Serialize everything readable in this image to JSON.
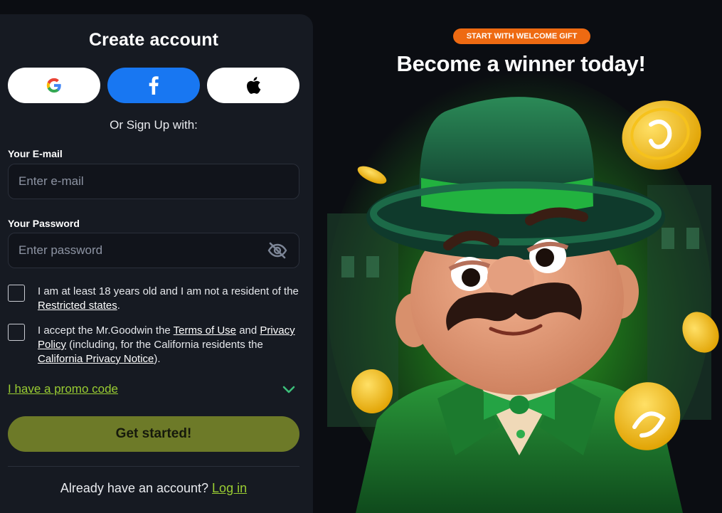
{
  "form": {
    "title": "Create account",
    "social_buttons": [
      "Google",
      "Facebook",
      "Apple"
    ],
    "or_text": "Or Sign Up with:",
    "email_label": "Your E-mail",
    "email_placeholder": "Enter e-mail",
    "password_label": "Your Password",
    "password_placeholder": "Enter password",
    "age_check": {
      "text_before": "I am at least 18 years old and I am not a resident of the ",
      "link": "Restricted states",
      "text_after": "."
    },
    "terms_check": {
      "text_1": "I accept the Mr.Goodwin the ",
      "link_1": "Terms of Use",
      "text_2": " and ",
      "link_2": "Privacy Policy",
      "text_3": " (including, for the California residents the ",
      "link_3": "California Privacy Notice",
      "text_4": ")."
    },
    "promo_label": "I have a promo code",
    "cta_label": "Get started!",
    "login_prompt": "Already have an account? ",
    "login_link": "Log in"
  },
  "hero": {
    "badge": "START WITH WELCOME GIFT",
    "headline": "Become a winner today!"
  },
  "colors": {
    "panel_bg": "#161a22",
    "accent_green": "#9acd32",
    "cta_bg": "#6d7a28",
    "badge_orange": "#ee6a12",
    "facebook_blue": "#1877f2"
  },
  "icons": [
    "google-icon",
    "facebook-icon",
    "apple-icon",
    "eye-off-icon",
    "chevron-down-icon"
  ]
}
